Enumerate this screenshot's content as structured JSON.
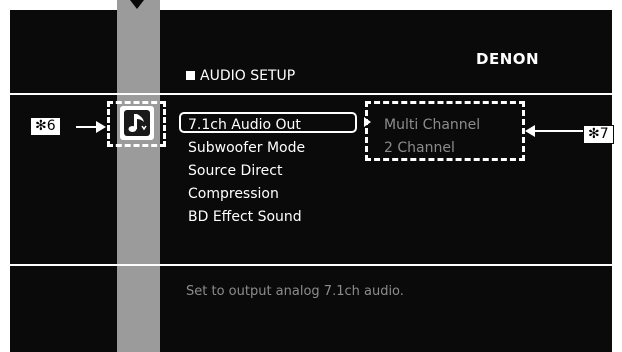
{
  "brand": "DENON",
  "section_title": "AUDIO SETUP",
  "menu": {
    "items": [
      {
        "label": "7.1ch Audio Out"
      },
      {
        "label": "Subwoofer Mode"
      },
      {
        "label": "Source Direct"
      },
      {
        "label": "Compression"
      },
      {
        "label": "BD Effect Sound"
      }
    ],
    "selected_index": 0
  },
  "options": {
    "items": [
      {
        "label": "Multi Channel"
      },
      {
        "label": "2 Channel"
      }
    ]
  },
  "description": "Set to output analog 7.1ch audio.",
  "callouts": {
    "icon_callout": "✻6",
    "options_callout": "✻7"
  },
  "icons": {
    "category_icon": "music-note-icon"
  },
  "colors": {
    "screen_bg": "#0a0a0a",
    "sidebar_bar": "#9b9b9b",
    "text_primary": "#ffffff",
    "text_dim": "#8c8c8c"
  }
}
